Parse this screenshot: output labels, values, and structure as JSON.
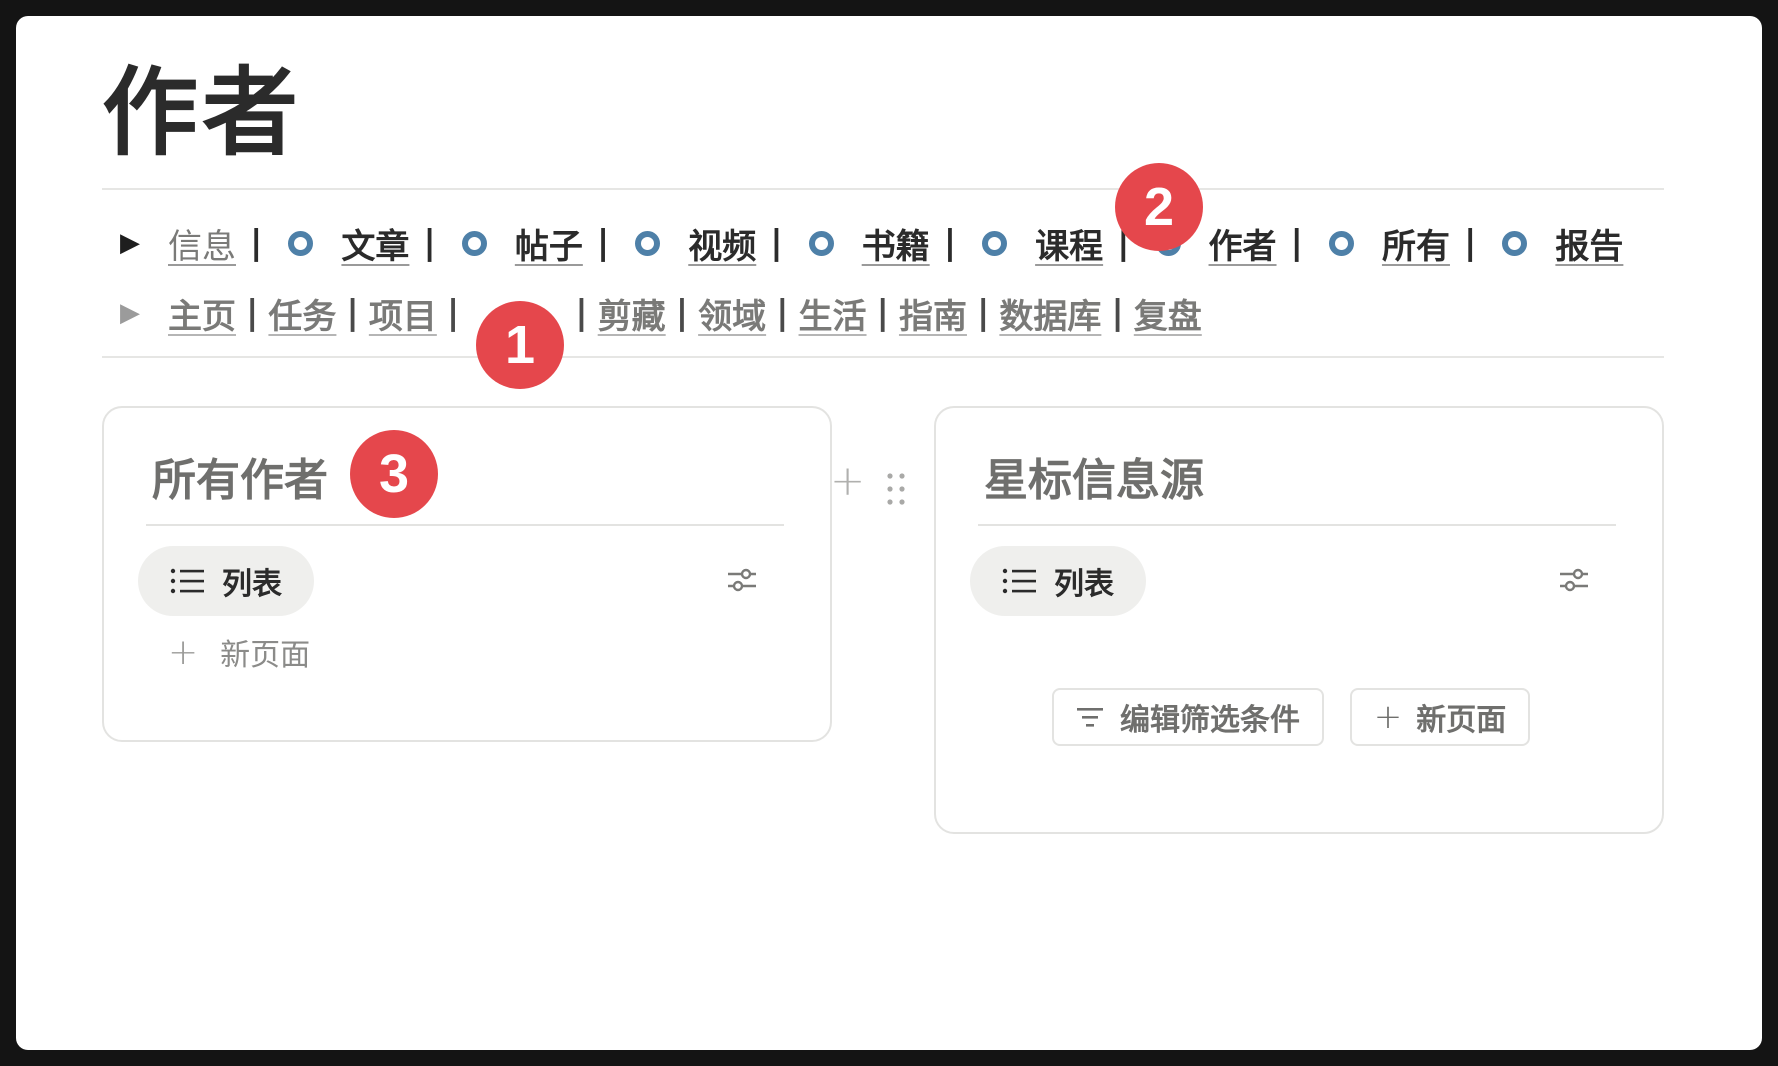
{
  "page": {
    "title": "作者"
  },
  "nav_row1": {
    "first_link": "信息",
    "items": [
      "文章",
      "帖子",
      "视频",
      "书籍",
      "课程",
      "作者",
      "所有",
      "报告"
    ],
    "ring_color": "#4e80a8"
  },
  "nav_row2": {
    "items": [
      "主页",
      "任务",
      "项目",
      "剪藏",
      "领域",
      "生活",
      "指南",
      "数据库",
      "复盘"
    ]
  },
  "separator": "|",
  "markers": [
    "1",
    "2",
    "3"
  ],
  "marker_color": "#e5474c",
  "card_left": {
    "title": "所有作者",
    "view_label": "列表",
    "new_page": "新页面"
  },
  "card_right": {
    "title": "星标信息源",
    "view_label": "列表",
    "filter_button": "编辑筛选条件",
    "new_page_button": "新页面"
  },
  "add_column": "+"
}
